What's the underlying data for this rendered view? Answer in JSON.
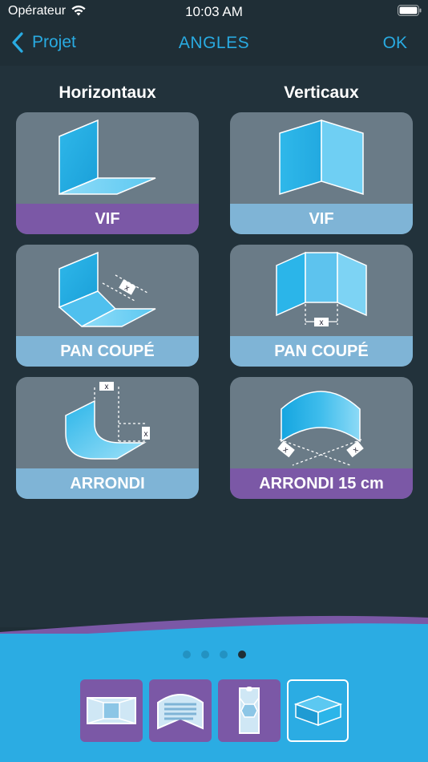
{
  "status_bar": {
    "carrier": "Opérateur",
    "time": "10:03 AM"
  },
  "nav": {
    "back_label": "Projet",
    "title": "ANGLES",
    "ok_label": "OK"
  },
  "columns": {
    "horizontal": "Horizontaux",
    "vertical": "Verticaux"
  },
  "cards": {
    "h_vif": "VIF",
    "v_vif": "VIF",
    "h_pan": "PAN COUPÉ",
    "v_pan": "PAN COUPÉ",
    "h_arrondi": "ARRONDI",
    "v_arrondi": "ARRONDI 15 cm"
  },
  "dimension_marker": "x",
  "pagination": {
    "count": 4,
    "active_index": 3
  },
  "colors": {
    "accent": "#29abe2",
    "purple": "#7b58a6",
    "light_blue": "#7fb4d6",
    "background": "#22323b",
    "card": "#6a7b87"
  }
}
